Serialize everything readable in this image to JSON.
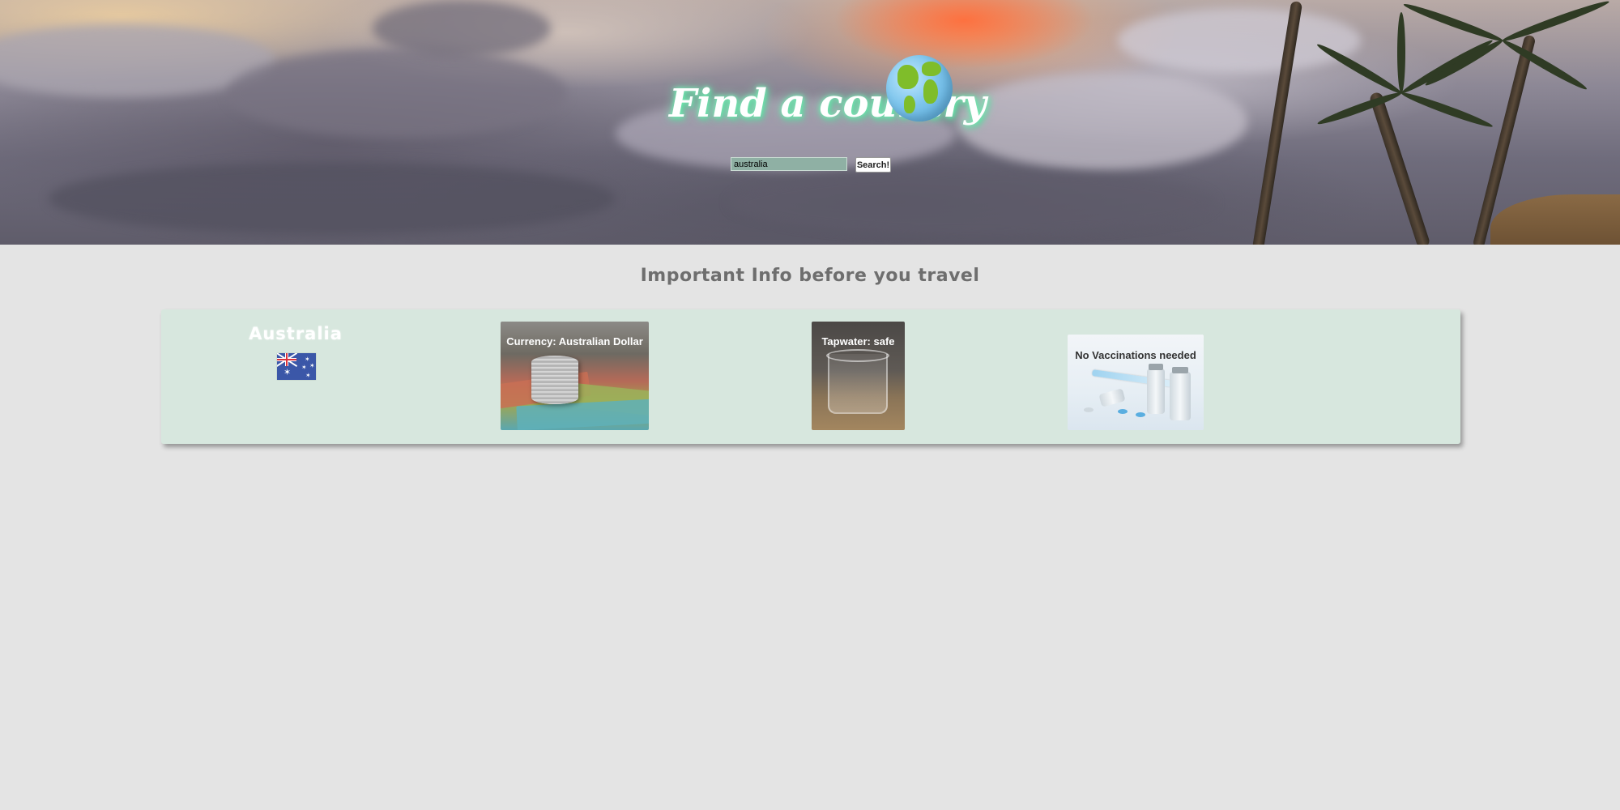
{
  "header": {
    "title": "Find a country",
    "globe_icon": "globe-icon"
  },
  "search": {
    "value": "australia",
    "button_label": "Search!"
  },
  "info": {
    "heading": "Important Info before you travel",
    "country_name": "Australia",
    "flag_icon": "australia-flag-icon",
    "currency_label": "Currency: Australian Dollar",
    "tapwater_label": "Tapwater: safe",
    "vaccination_label": "No Vaccinations needed"
  },
  "colors": {
    "page_background": "#e4e4e4",
    "panel_background": "#d7e7de",
    "title_glow": "#4fd89a",
    "heading_text": "#6e6e6e"
  }
}
